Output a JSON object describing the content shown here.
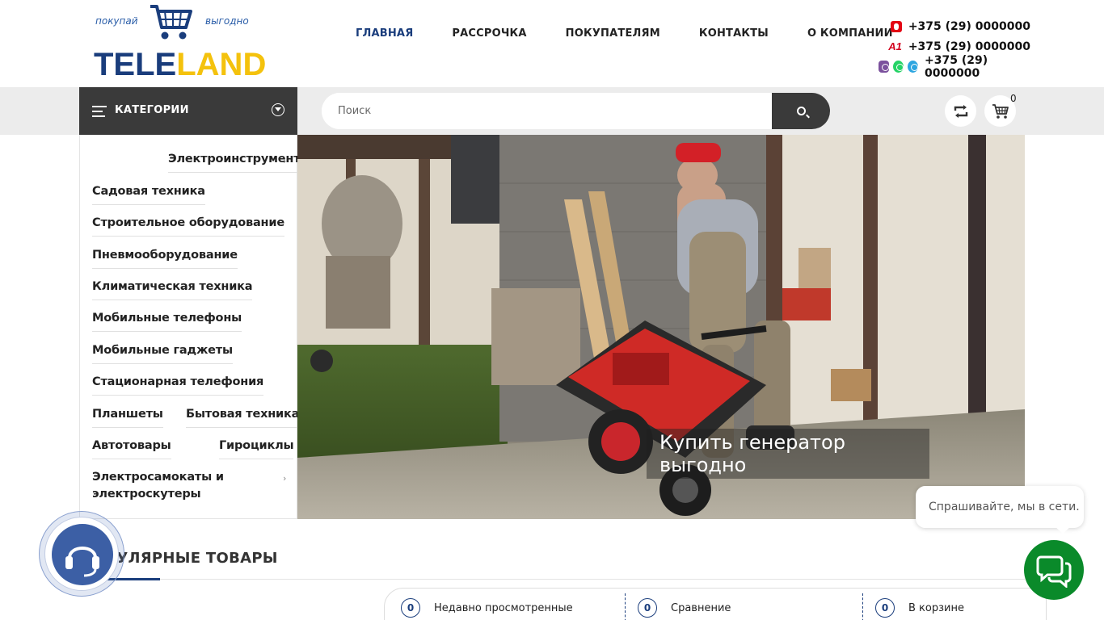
{
  "header": {
    "logo": {
      "tagline_left": "покупай",
      "tagline_right": "выгодно",
      "brand_part1": "TELE",
      "brand_part2": "LAND"
    },
    "nav": [
      {
        "label": "ГЛАВНАЯ",
        "active": true
      },
      {
        "label": "РАССРОЧКА",
        "active": false
      },
      {
        "label": "ПОКУПАТЕЛЯМ",
        "active": false
      },
      {
        "label": "КОНТАКТЫ",
        "active": false
      },
      {
        "label": "О КОМПАНИИ",
        "active": false
      }
    ],
    "phones": [
      {
        "operator_icon": "mts-icon",
        "number": "+375 (29) 0000000"
      },
      {
        "operator_icon": "a1-icon",
        "operator_text": "A1",
        "number": "+375 (29) 0000000"
      },
      {
        "operator_icon": "messengers-icons",
        "number": "+375 (29) 0000000"
      }
    ]
  },
  "toolbar": {
    "categories_label": "КАТЕГОРИИ",
    "search_placeholder": "Поиск",
    "cart_count": "0"
  },
  "categories": [
    "Электроинструмент",
    "Садовая техника",
    "Строительное оборудование",
    "Пневмооборудование",
    "Климатическая техника",
    "Мобильные телефоны",
    "Мобильные гаджеты",
    "Стационарная телефония",
    "Планшеты",
    "Бытовая техника",
    "Автотовары",
    "Гироциклы",
    "Электросамокаты и электроскутеры"
  ],
  "banner": {
    "caption": "Купить генератор выгодно"
  },
  "popular": {
    "title": "ПОПУЛЯРНЫЕ ТОВАРЫ"
  },
  "bottom_bar": [
    {
      "count": "0",
      "label": "Недавно просмотренные"
    },
    {
      "count": "0",
      "label": "Сравнение"
    },
    {
      "count": "0",
      "label": "В корзине"
    }
  ],
  "chat": {
    "bubble_text": "Спрашивайте, мы в сети."
  },
  "colors": {
    "brand_blue": "#1a3d7c",
    "brand_yellow": "#f4c20d",
    "dark_bar": "#3a3a3a",
    "chat_green": "#0a8a2a"
  }
}
